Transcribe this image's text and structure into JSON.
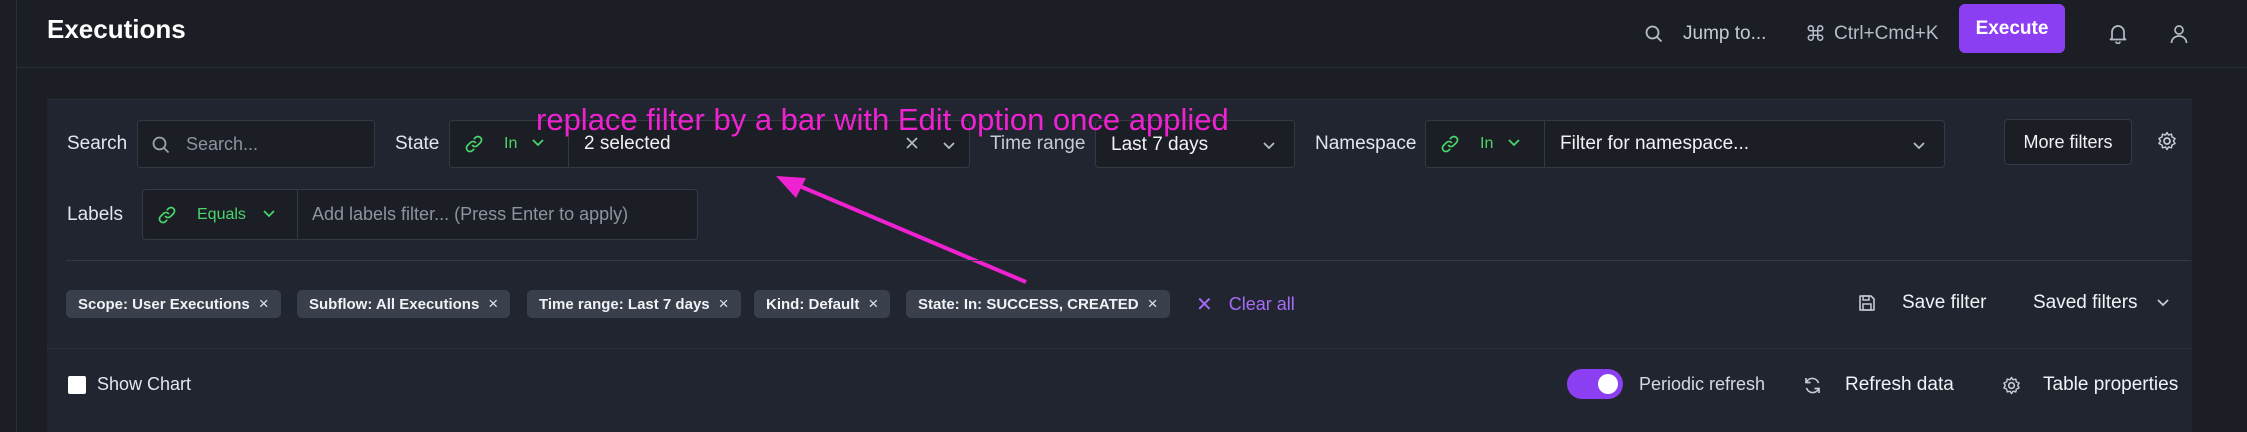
{
  "header": {
    "title": "Executions",
    "jump_label": "Jump to...",
    "shortcut_label": "Ctrl+Cmd+K",
    "shortcut_symbol": "⌘",
    "execute_label": "Execute"
  },
  "filters": {
    "search_label": "Search",
    "search_placeholder": "Search...",
    "state_label": "State",
    "state_operator": "In",
    "state_value": "2 selected",
    "time_range_label": "Time range",
    "time_range_value": "Last 7 days",
    "namespace_label": "Namespace",
    "namespace_operator": "In",
    "namespace_placeholder": "Filter for namespace...",
    "more_filters_label": "More filters",
    "labels_label": "Labels",
    "labels_operator": "Equals",
    "labels_placeholder": "Add labels filter... (Press Enter to apply)"
  },
  "annotation": "replace filter by a bar with Edit option once applied",
  "chips": [
    "Scope: User Executions",
    "Subflow: All Executions",
    "Time range: Last 7 days",
    "Kind: Default",
    "State: In: SUCCESS, CREATED"
  ],
  "clear_all_label": "Clear all",
  "save_filter_label": "Save filter",
  "saved_filters_label": "Saved filters",
  "footer": {
    "show_chart_label": "Show Chart",
    "periodic_refresh_label": "Periodic refresh",
    "periodic_refresh_on": true,
    "refresh_data_label": "Refresh data",
    "table_properties_label": "Table properties"
  },
  "colors": {
    "accent": "#8c3ff2",
    "operator_green": "#4bd46b",
    "annotation_magenta": "#ee22d0",
    "clear_all_purple": "#a76cf6"
  }
}
